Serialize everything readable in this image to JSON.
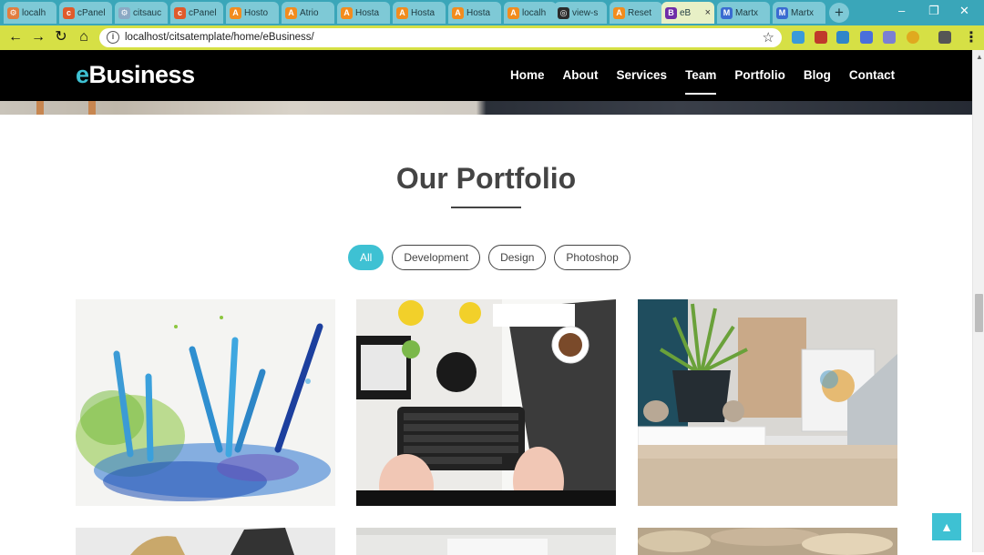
{
  "browser": {
    "tabs": [
      {
        "title": "localh",
        "fav_color": "#e27d3f",
        "fav": "⚙"
      },
      {
        "title": "cPanel",
        "fav_color": "#e05a2b",
        "fav": "c"
      },
      {
        "title": "citsauc",
        "fav_color": "#8aa9c4",
        "fav": "⚙"
      },
      {
        "title": "cPanel",
        "fav_color": "#e05a2b",
        "fav": "c"
      },
      {
        "title": "Hosto",
        "fav_color": "#f28c1e",
        "fav": "A"
      },
      {
        "title": "Atrio",
        "fav_color": "#f28c1e",
        "fav": "A"
      },
      {
        "title": "Hosta",
        "fav_color": "#f28c1e",
        "fav": "A"
      },
      {
        "title": "Hosta",
        "fav_color": "#f28c1e",
        "fav": "A"
      },
      {
        "title": "Hosta",
        "fav_color": "#f28c1e",
        "fav": "A"
      },
      {
        "title": "localh",
        "fav_color": "#f28c1e",
        "fav": "A"
      },
      {
        "title": "view-s",
        "fav_color": "#2b2b2b",
        "fav": "◎"
      },
      {
        "title": "Reset",
        "fav_color": "#f28c1e",
        "fav": "A"
      },
      {
        "title": "eB",
        "fav_color": "#6f2da8",
        "fav": "B",
        "active": true
      },
      {
        "title": "Martx",
        "fav_color": "#3a6bd1",
        "fav": "M"
      },
      {
        "title": "Martx",
        "fav_color": "#3a6bd1",
        "fav": "M"
      }
    ],
    "tab_close": "×",
    "new_tab": "+",
    "window_controls": [
      "–",
      "❐",
      "✕"
    ],
    "url": "localhost/citsatemplate/home/eBusiness/",
    "info_icon": "i",
    "bookmark_icon": "☆",
    "nav_icons": {
      "back": "←",
      "forward": "→",
      "reload": "↻",
      "home": "⌂"
    },
    "menu_icon": "⋮",
    "toolbar_color": "#d6e045",
    "tabstrip_color": "#3aa6b9"
  },
  "site": {
    "logo_accent": "e",
    "logo_rest": "Business",
    "nav": [
      "Home",
      "About",
      "Services",
      "Team",
      "Portfolio",
      "Blog",
      "Contact"
    ],
    "active_nav": "Team",
    "accent_color": "#3ec1d3"
  },
  "portfolio": {
    "title": "Our Portfolio",
    "filters": [
      "All",
      "Development",
      "Design",
      "Photoshop"
    ],
    "active_filter": "All"
  },
  "back_to_top_icon": "▲"
}
